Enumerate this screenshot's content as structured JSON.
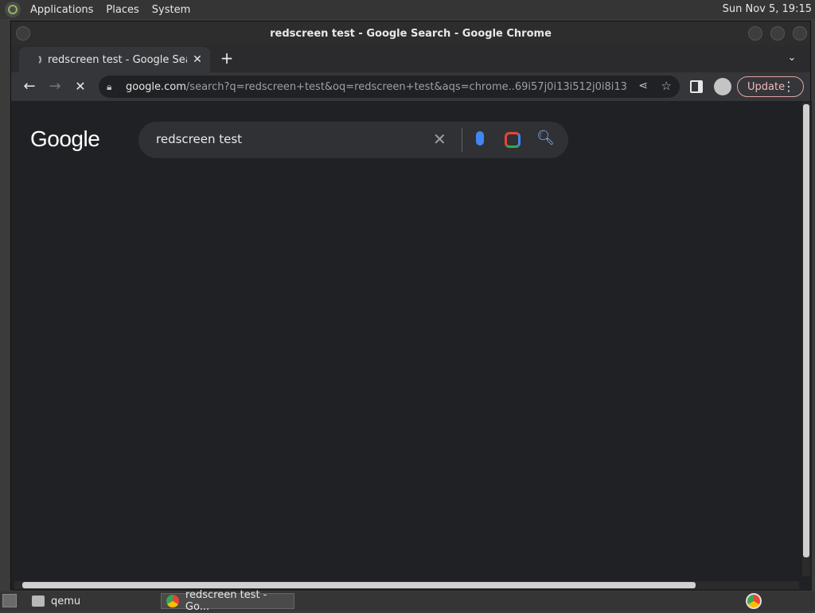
{
  "top_panel": {
    "menus": [
      "Applications",
      "Places",
      "System"
    ],
    "clock": "Sun Nov 5, 19:15"
  },
  "window": {
    "title": "redscreen test - Google Search - Google Chrome"
  },
  "tabs": [
    {
      "title": "redscreen test - Google Search",
      "loading": true
    }
  ],
  "toolbar": {
    "url_host": "google.com",
    "url_rest": "/search?q=redscreen+test&oq=redscreen+test&aqs=chrome..69i57j0i13i512j0i8i13i30j0i...",
    "update_label": "Update"
  },
  "search": {
    "query": "redscreen test",
    "logo_text": "Google"
  },
  "taskbar": {
    "tasks": [
      "qemu",
      "redscreen test - Go..."
    ]
  },
  "colors": {
    "accent_update": "#f2b8b5",
    "search_icon": "#8ab4f8"
  }
}
